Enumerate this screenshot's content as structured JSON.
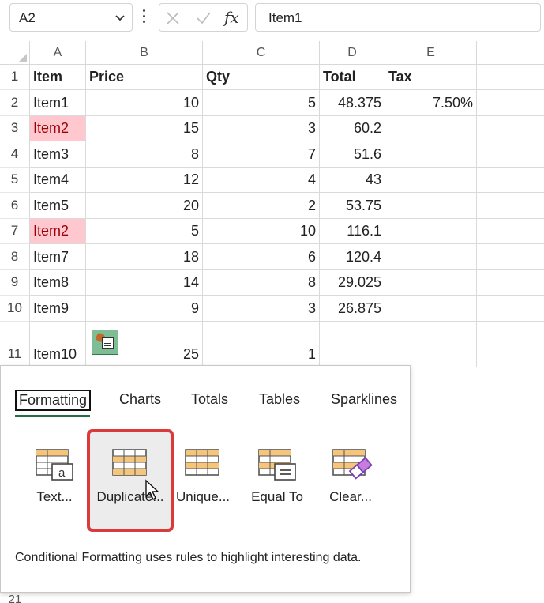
{
  "formula_bar": {
    "name_box": "A2",
    "formula": "Item1",
    "fx_label": "fx"
  },
  "columns": [
    "A",
    "B",
    "C",
    "D",
    "E"
  ],
  "rows": [
    {
      "num": "1",
      "cells": [
        "Item",
        "Price",
        "Qty",
        "Total",
        "Tax"
      ],
      "header": true
    },
    {
      "num": "2",
      "cells": [
        "Item1",
        "10",
        "5",
        "48.375",
        "7.50%"
      ]
    },
    {
      "num": "3",
      "cells": [
        "Item2",
        "15",
        "3",
        "60.2",
        ""
      ],
      "dup": true
    },
    {
      "num": "4",
      "cells": [
        "Item3",
        "8",
        "7",
        "51.6",
        ""
      ]
    },
    {
      "num": "5",
      "cells": [
        "Item4",
        "12",
        "4",
        "43",
        ""
      ]
    },
    {
      "num": "6",
      "cells": [
        "Item5",
        "20",
        "2",
        "53.75",
        ""
      ]
    },
    {
      "num": "7",
      "cells": [
        "Item2",
        "5",
        "10",
        "116.1",
        ""
      ],
      "dup": true
    },
    {
      "num": "8",
      "cells": [
        "Item7",
        "18",
        "6",
        "120.4",
        ""
      ]
    },
    {
      "num": "9",
      "cells": [
        "Item8",
        "14",
        "8",
        "29.025",
        ""
      ]
    },
    {
      "num": "10",
      "cells": [
        "Item9",
        "9",
        "3",
        "26.875",
        ""
      ]
    },
    {
      "num": "11",
      "cells": [
        "Item10",
        "25",
        "1",
        "",
        ""
      ]
    }
  ],
  "next_row_partial": "21",
  "quick_analysis": {
    "tabs": [
      {
        "label": "Formatting",
        "active": true
      },
      {
        "label": "Charts"
      },
      {
        "label": "Totals"
      },
      {
        "label": "Tables"
      },
      {
        "label": "Sparklines"
      }
    ],
    "options": [
      {
        "label": "Text...",
        "icon": "text-contains-icon"
      },
      {
        "label": "Duplicate...",
        "icon": "duplicate-values-icon",
        "selected": true
      },
      {
        "label": "Unique...",
        "icon": "unique-values-icon"
      },
      {
        "label": "Equal To",
        "icon": "equal-to-icon"
      },
      {
        "label": "Clear...",
        "icon": "clear-format-icon"
      }
    ],
    "description": "Conditional Formatting uses rules to highlight interesting data."
  },
  "colors": {
    "duplicate_fill": "#ffc7ce",
    "duplicate_text": "#9c0006",
    "accent_green": "#1e7145",
    "selection_border": "#d93a3a"
  }
}
